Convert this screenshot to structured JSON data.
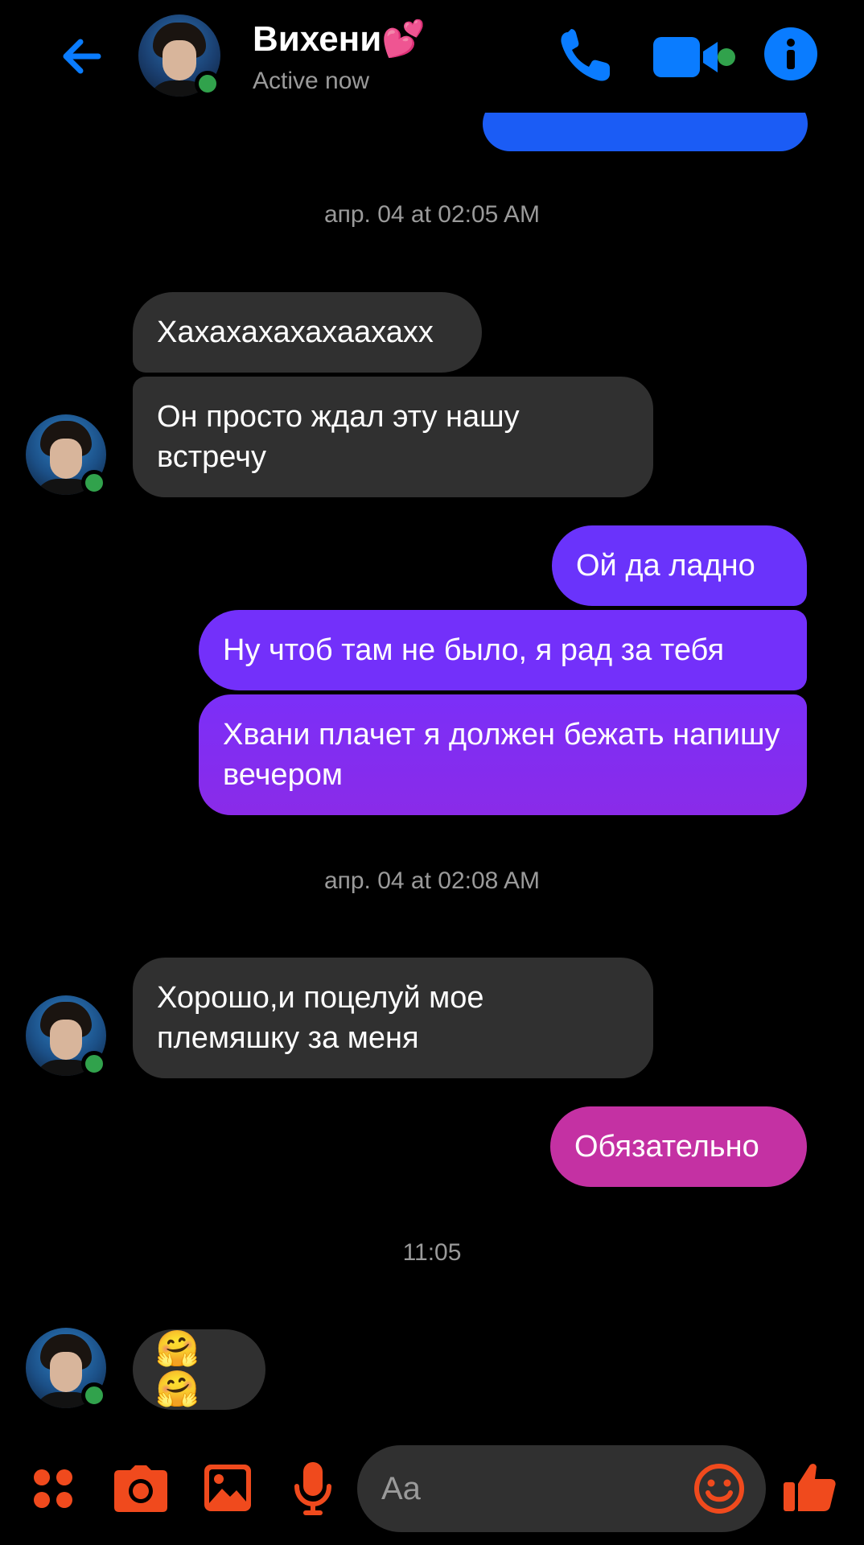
{
  "header": {
    "back_icon": "arrow-left-icon",
    "contact_name": "Вихени💕",
    "status": "Active now",
    "call_icon": "phone-icon",
    "video_icon": "video-camera-icon",
    "info_icon": "info-icon",
    "accent_color": "#0a7cff"
  },
  "messages": {
    "ts1": "апр. 04 at 02:05 AM",
    "m1": "Хахахахахахаахахх",
    "m2": "Он просто ждал эту нашу встречу",
    "m3": "Ой да ладно",
    "m4": "Ну чтоб там не было, я рад за тебя",
    "m5": "Хвани плачет я должен бежать напишу вечером",
    "ts2": "апр. 04 at 02:08 AM",
    "m6": "Хорошо,и поцелуй мое племяшку за меня",
    "m7": "Обязательно",
    "ts3": "11:05",
    "m8": "🤗🤗"
  },
  "composer": {
    "placeholder": "Aa",
    "menu_icon": "four-dots-icon",
    "camera_icon": "camera-icon",
    "gallery_icon": "image-icon",
    "mic_icon": "microphone-icon",
    "emoji_icon": "smiley-icon",
    "like_icon": "thumbs-up-icon",
    "accent_color": "#f04a1d"
  }
}
